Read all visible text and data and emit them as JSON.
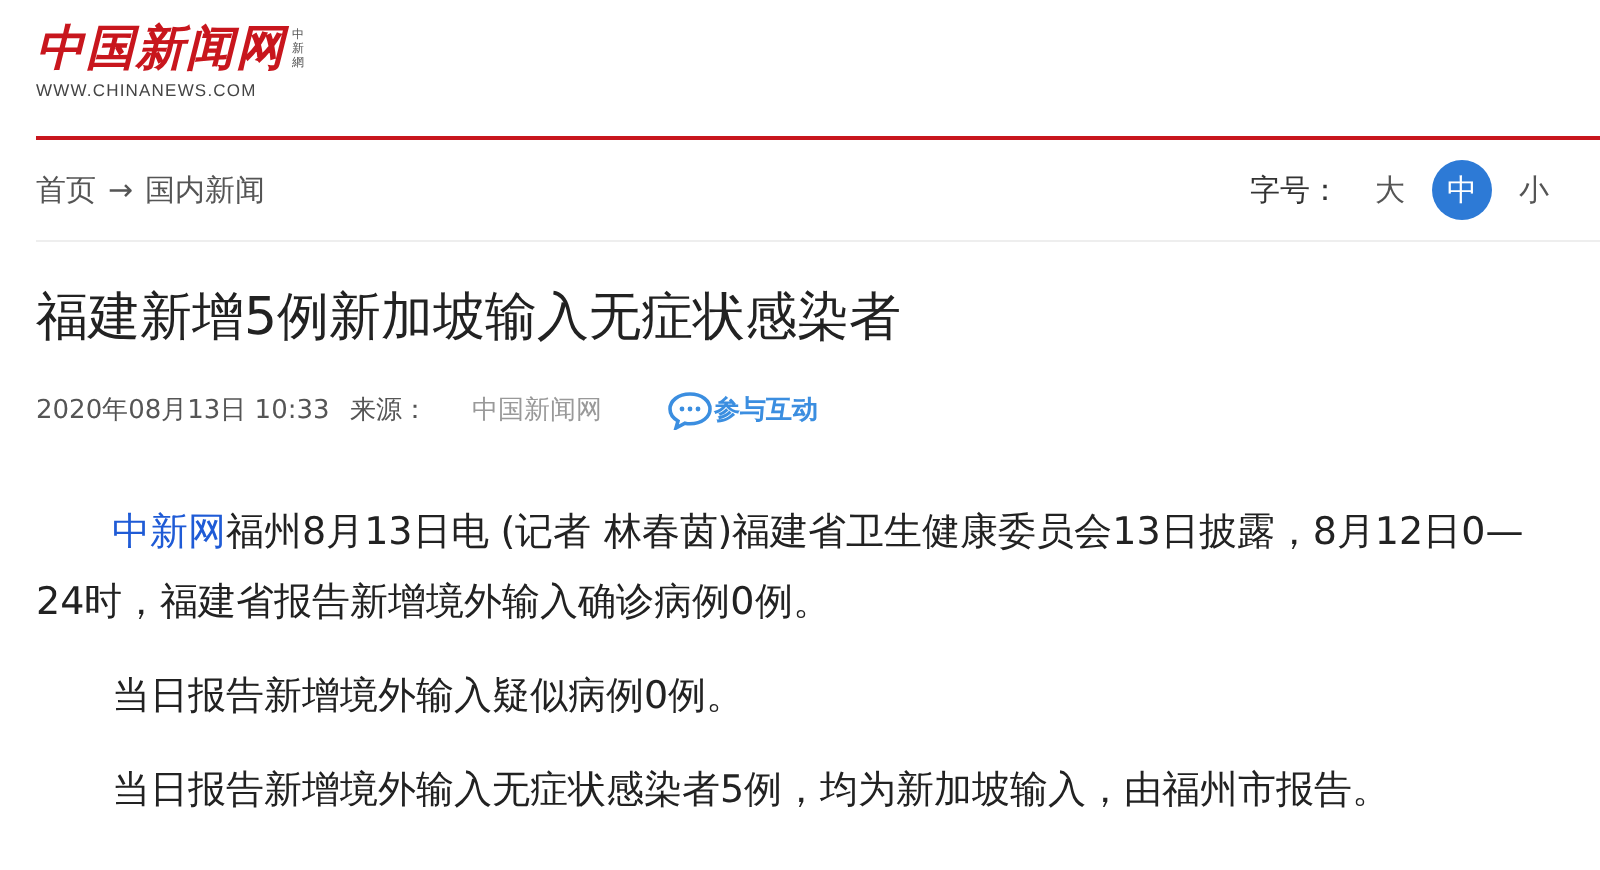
{
  "logo": {
    "name": "中国新闻网",
    "side": "中新網",
    "url": "WWW.CHINANEWS.COM"
  },
  "breadcrumb": [
    "首页",
    "国内新闻"
  ],
  "breadcrumb_separator": "→",
  "font_size": {
    "label": "字号：",
    "options": [
      {
        "label": "大",
        "selected": false
      },
      {
        "label": "中",
        "selected": true
      },
      {
        "label": "小",
        "selected": false
      }
    ]
  },
  "title": "福建新增5例新加坡输入无症状感染者",
  "meta": {
    "time": "2020年08月13日 10:33",
    "source_label": "来源：",
    "source": "中国新闻网",
    "interact": "参与互动"
  },
  "paragraphs": [
    {
      "lead": "中新网",
      "text": "福州8月13日电 (记者 林春茵)福建省卫生健康委员会13日披露，8月12日0—24时，福建省报告新增境外输入确诊病例0例。"
    },
    {
      "text": "当日报告新增境外输入疑似病例0例。"
    },
    {
      "text": "当日报告新增境外输入无症状感染者5例，均为新加坡输入，由福州市报告。"
    }
  ]
}
